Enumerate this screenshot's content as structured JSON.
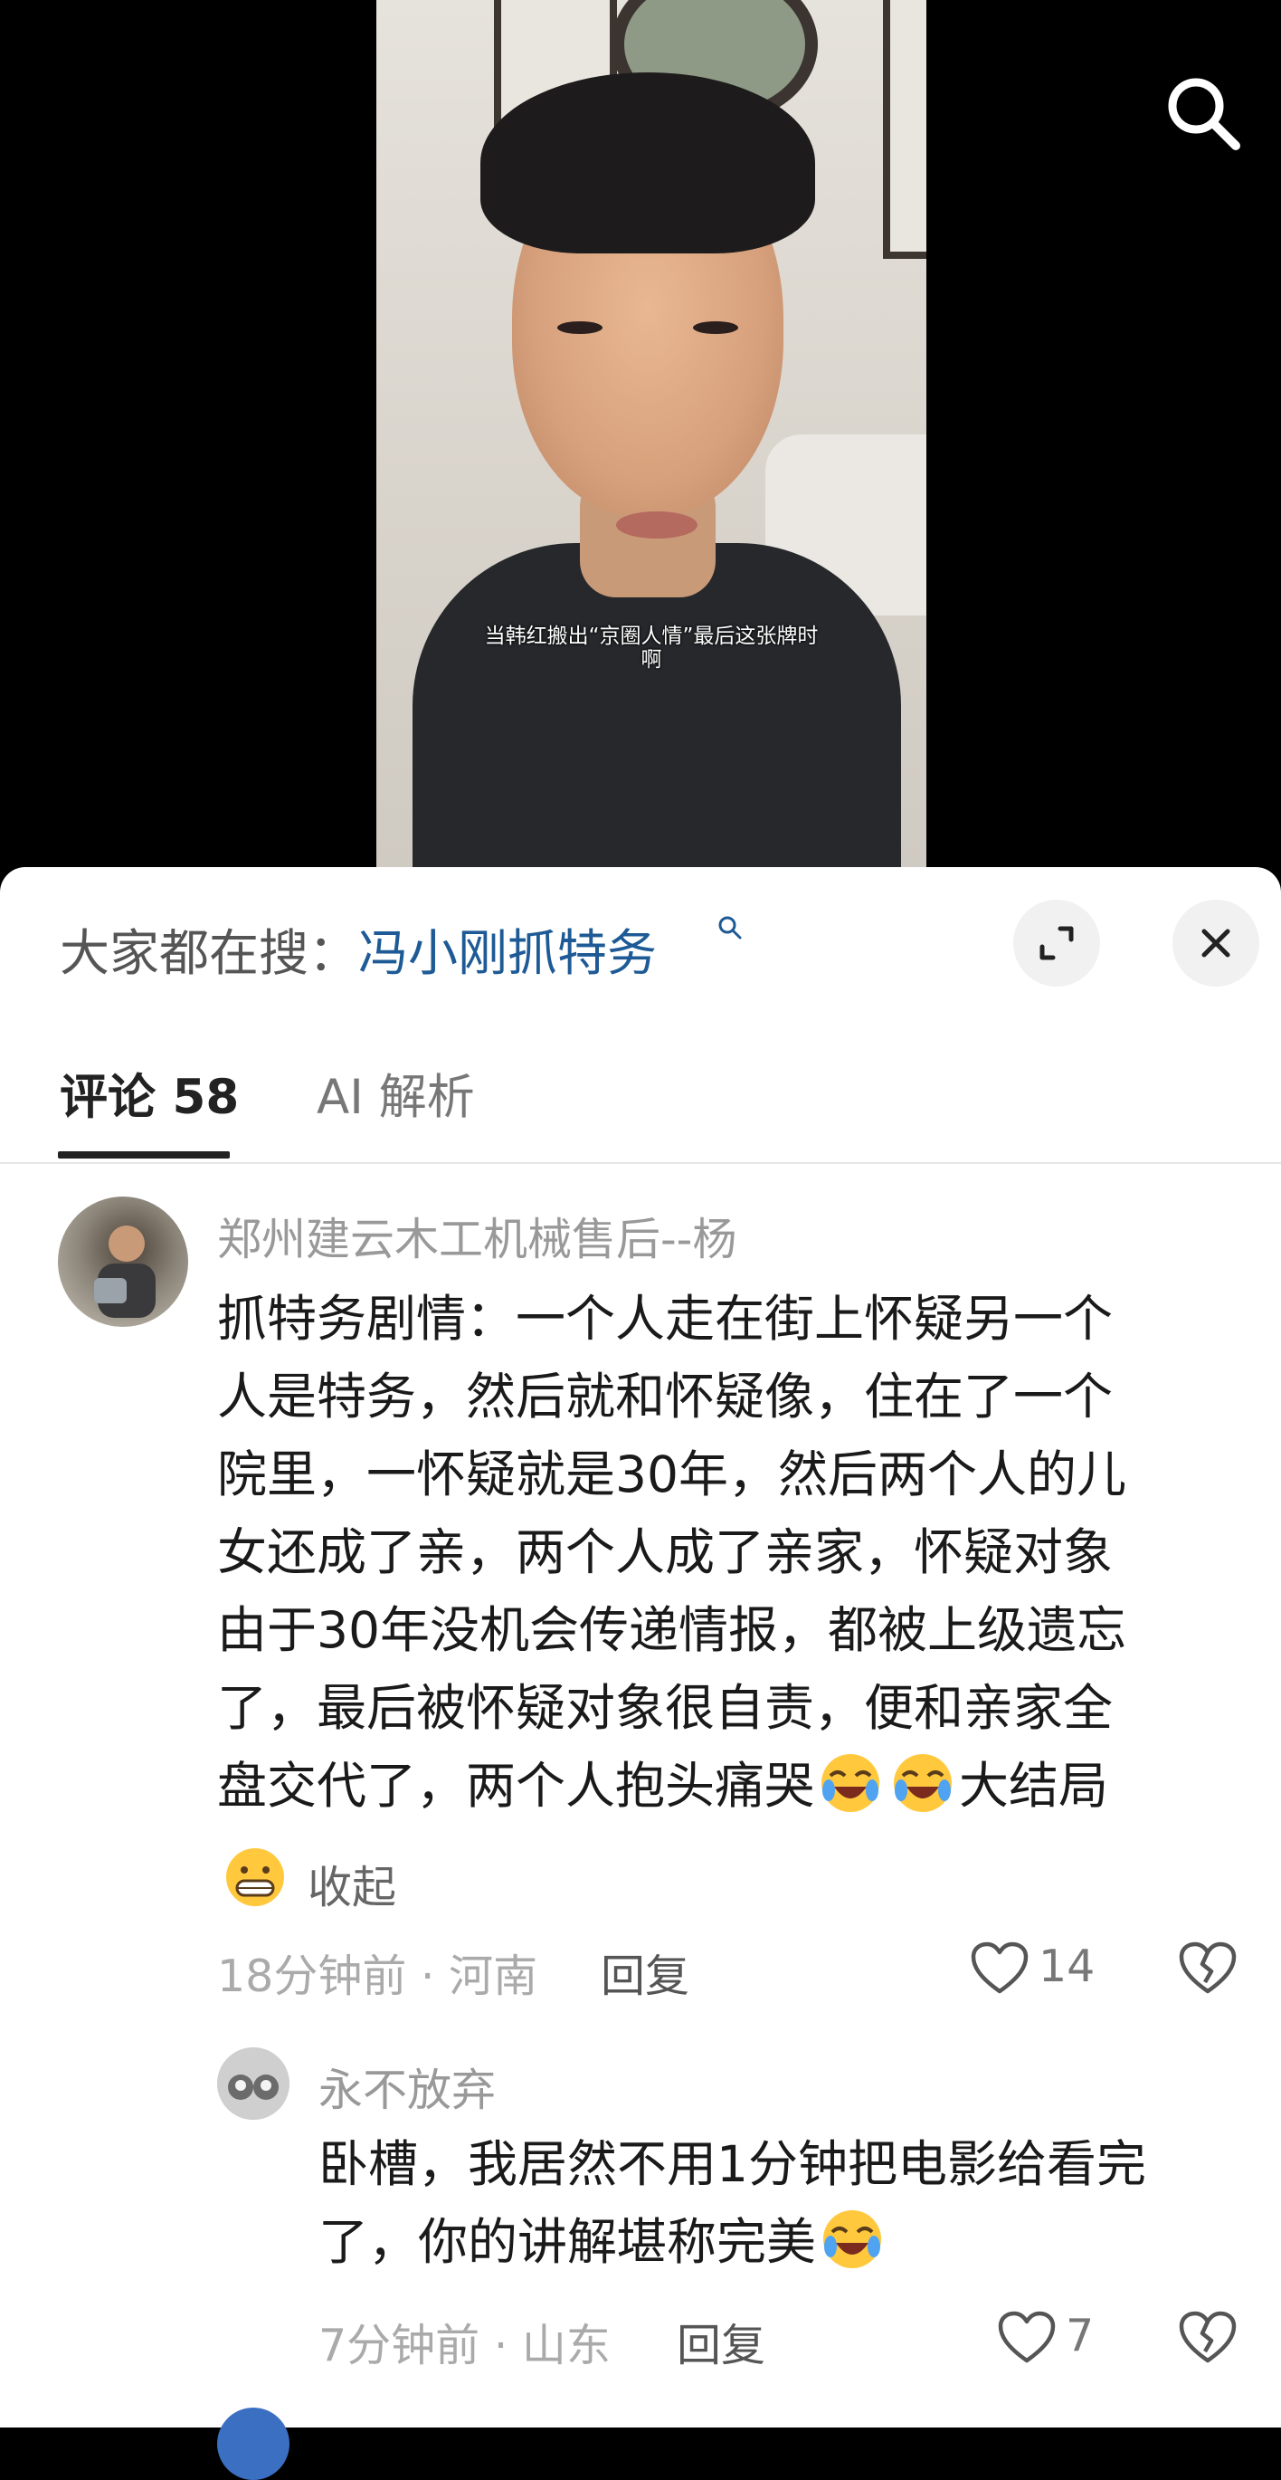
{
  "video": {
    "caption_line1": "当韩红搬出“京圈人情”最后这张牌时",
    "caption_line2": "啊"
  },
  "hot_search": {
    "label": "大家都在搜：",
    "keyword": "冯小刚抓特务"
  },
  "tabs": {
    "comments": "评论 58",
    "ai": "AI 解析"
  },
  "comments": [
    {
      "username": "郑州建云木工机械售后--杨",
      "lines": [
        "抓特务剧情：一个人走在街上怀疑另一个",
        "人是特务，然后就和怀疑像，住在了一个",
        "院里，一怀疑就是30年，然后两个人的儿",
        "女还成了亲，两个人成了亲家，怀疑对象",
        "由于30年没机会传递情报，都被上级遗忘",
        "了，最后被怀疑对象很自责，便和亲家全",
        "盘交代了，两个人抱头痛哭",
        "大结局"
      ],
      "collapse": "收起",
      "meta": "18分钟前 · 河南",
      "reply": "回复",
      "likes": "14"
    },
    {
      "username": "永不放弃",
      "lines": [
        "卧槽，我居然不用1分钟把电影给看完",
        "了，你的讲解堪称完美"
      ],
      "meta": "7分钟前 · 山东",
      "reply": "回复",
      "likes": "7"
    }
  ],
  "colors": {
    "keyword": "#1e5a95",
    "panel": "#ffffff",
    "muted": "#999999"
  },
  "icons": [
    "search-icon",
    "expand-icon",
    "close-icon",
    "heart-icon",
    "broken-heart-icon",
    "laugh-cry-emoji",
    "grin-emoji"
  ]
}
